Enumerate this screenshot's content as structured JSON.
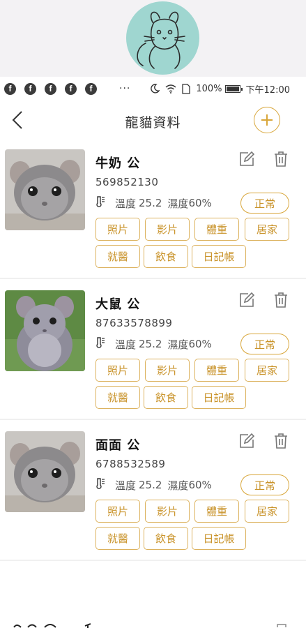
{
  "header": {
    "title": "龍貓資料"
  },
  "statusbar": {
    "battery": "100%",
    "time": "下午12:00",
    "dots": "···",
    "fb_icons": [
      "f",
      "f",
      "f",
      "f",
      "f"
    ]
  },
  "labels": {
    "temp": "溫度",
    "humidity": "濕度",
    "status": "正常"
  },
  "buttons": [
    "照片",
    "影片",
    "體重",
    "居家",
    "就醫",
    "飲食",
    "日記帳"
  ],
  "pets": [
    {
      "name": "牛奶 公",
      "chip": "569852130",
      "temp": "25.2",
      "humidity": "60%",
      "status": "正常"
    },
    {
      "name": "大鼠 公",
      "chip": "87633578899",
      "temp": "25.2",
      "humidity": "60%",
      "status": "正常"
    },
    {
      "name": "面面 公",
      "chip": "6788532589",
      "temp": "25.2",
      "humidity": "60%",
      "status": "正常"
    }
  ],
  "colors": {
    "accent": "#d8a63a",
    "accent_text": "#c9932a",
    "logo_bg": "#9fd6d0"
  },
  "icons": {
    "back": "chevron-left-icon",
    "add": "plus-circle-icon",
    "edit": "edit-icon",
    "delete": "trash-icon",
    "thermometer": "thermometer-icon"
  }
}
